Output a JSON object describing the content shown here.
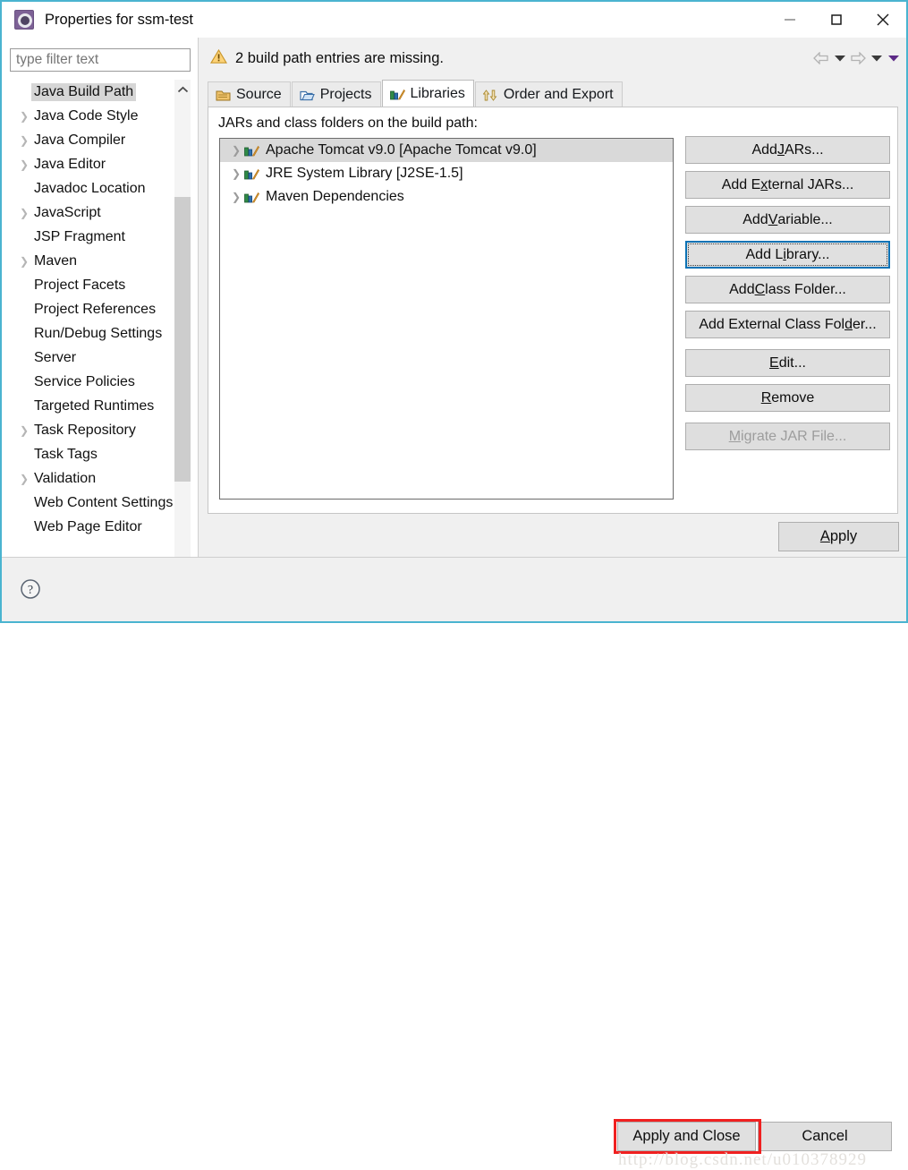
{
  "window": {
    "title": "Properties for ssm-test",
    "app_icon": "eclipse-gear-icon",
    "controls": {
      "minimize": "minimize-icon",
      "maximize": "maximize-icon",
      "close": "close-icon"
    },
    "accent_border": "#4ab4d0"
  },
  "sidebar": {
    "filter": {
      "placeholder": "type filter text",
      "value": ""
    },
    "items": [
      {
        "label": "Java Build Path",
        "expandable": false,
        "selected": true
      },
      {
        "label": "Java Code Style",
        "expandable": true,
        "selected": false
      },
      {
        "label": "Java Compiler",
        "expandable": true,
        "selected": false
      },
      {
        "label": "Java Editor",
        "expandable": true,
        "selected": false
      },
      {
        "label": "Javadoc Location",
        "expandable": false,
        "selected": false
      },
      {
        "label": "JavaScript",
        "expandable": true,
        "selected": false
      },
      {
        "label": "JSP Fragment",
        "expandable": false,
        "selected": false
      },
      {
        "label": "Maven",
        "expandable": true,
        "selected": false
      },
      {
        "label": "Project Facets",
        "expandable": false,
        "selected": false
      },
      {
        "label": "Project References",
        "expandable": false,
        "selected": false
      },
      {
        "label": "Run/Debug Settings",
        "expandable": false,
        "selected": false
      },
      {
        "label": "Server",
        "expandable": false,
        "selected": false
      },
      {
        "label": "Service Policies",
        "expandable": false,
        "selected": false
      },
      {
        "label": "Targeted Runtimes",
        "expandable": false,
        "selected": false
      },
      {
        "label": "Task Repository",
        "expandable": true,
        "selected": false
      },
      {
        "label": "Task Tags",
        "expandable": false,
        "selected": false
      },
      {
        "label": "Validation",
        "expandable": true,
        "selected": false
      },
      {
        "label": "Web Content Settings",
        "expandable": false,
        "selected": false
      },
      {
        "label": "Web Page Editor",
        "expandable": false,
        "selected": false
      }
    ],
    "scroll_up_icon": "chevron-up-icon",
    "scroll_down_icon": "chevron-down-icon",
    "scroll_left_icon": "chevron-left-icon",
    "scroll_right_icon": "chevron-right-icon"
  },
  "header": {
    "warning_icon": "warning-triangle-icon",
    "warning_text": "2 build path entries are missing.",
    "nav": {
      "back_icon": "arrow-left-icon",
      "back_menu_icon": "caret-down-icon",
      "forward_icon": "arrow-right-icon",
      "forward_menu_icon": "caret-down-icon",
      "page_menu_icon": "caret-down-purple-icon"
    }
  },
  "main": {
    "tabs": [
      {
        "label": "Source",
        "icon": "source-folder-icon",
        "active": false
      },
      {
        "label": "Projects",
        "icon": "projects-folder-icon",
        "active": false
      },
      {
        "label": "Libraries",
        "icon": "library-books-icon",
        "active": true
      },
      {
        "label": "Order and Export",
        "icon": "order-export-icon",
        "active": false
      }
    ],
    "body_label": "JARs and class folders on the build path:",
    "libraries": [
      {
        "label": "Apache Tomcat v9.0 [Apache Tomcat v9.0]",
        "icon": "library-books-icon",
        "expandable": true,
        "selected": true
      },
      {
        "label": "JRE System Library [J2SE-1.5]",
        "icon": "library-books-icon",
        "expandable": true,
        "selected": false
      },
      {
        "label": "Maven Dependencies",
        "icon": "library-books-icon",
        "expandable": true,
        "selected": false
      }
    ],
    "buttons": [
      {
        "pre": "Add ",
        "mnemonic": "J",
        "post": "ARs...",
        "state": "normal",
        "name": "add-jars-button"
      },
      {
        "pre": "Add E",
        "mnemonic": "x",
        "post": "ternal JARs...",
        "state": "normal",
        "name": "add-external-jars-button"
      },
      {
        "pre": "Add ",
        "mnemonic": "V",
        "post": "ariable...",
        "state": "normal",
        "name": "add-variable-button"
      },
      {
        "pre": "Add L",
        "mnemonic": "i",
        "post": "brary...",
        "state": "focused",
        "name": "add-library-button"
      },
      {
        "pre": "Add ",
        "mnemonic": "C",
        "post": "lass Folder...",
        "state": "normal",
        "name": "add-class-folder-button"
      },
      {
        "pre": "Add External Class Fol",
        "mnemonic": "d",
        "post": "er...",
        "state": "normal",
        "name": "add-external-class-folder-button"
      },
      {
        "pre": "",
        "mnemonic": "E",
        "post": "dit...",
        "state": "spaced",
        "name": "edit-button"
      },
      {
        "pre": "",
        "mnemonic": "R",
        "post": "emove",
        "state": "normal",
        "name": "remove-button"
      },
      {
        "pre": "",
        "mnemonic": "M",
        "post": "igrate JAR File...",
        "state": "disabled",
        "name": "migrate-jar-file-button"
      }
    ],
    "apply_label": "Apply"
  },
  "footer": {
    "help_icon": "help-question-icon",
    "apply_and_close_label": "Apply and Close",
    "cancel_label": "Cancel",
    "annotation_color": "#f02020",
    "watermark": "http://blog.csdn.net/u010378929"
  }
}
